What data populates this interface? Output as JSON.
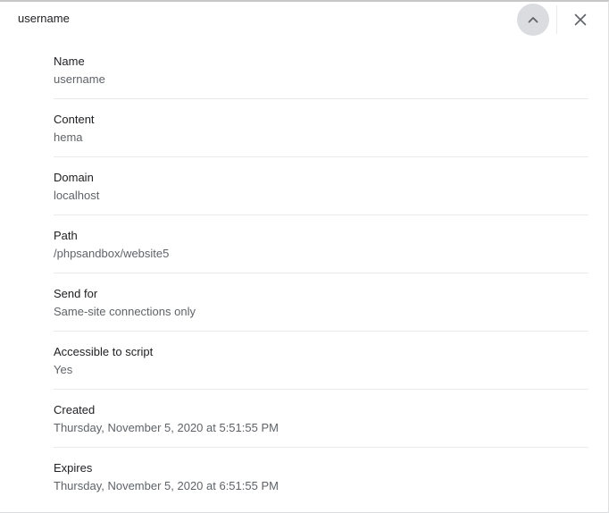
{
  "header": {
    "title": "username",
    "collapse_icon": "chevron-up-icon",
    "close_icon": "close-icon"
  },
  "fields": [
    {
      "label": "Name",
      "value": "username"
    },
    {
      "label": "Content",
      "value": "hema"
    },
    {
      "label": "Domain",
      "value": "localhost"
    },
    {
      "label": "Path",
      "value": "/phpsandbox/website5"
    },
    {
      "label": "Send for",
      "value": "Same-site connections only"
    },
    {
      "label": "Accessible to script",
      "value": "Yes"
    },
    {
      "label": "Created",
      "value": "Thursday, November 5, 2020 at 5:51:55 PM"
    },
    {
      "label": "Expires",
      "value": "Thursday, November 5, 2020 at 6:51:55 PM"
    }
  ],
  "colors": {
    "button_bg": "#dadce0",
    "label": "#202124",
    "value": "#5f6368",
    "divider": "#e8eaed"
  }
}
